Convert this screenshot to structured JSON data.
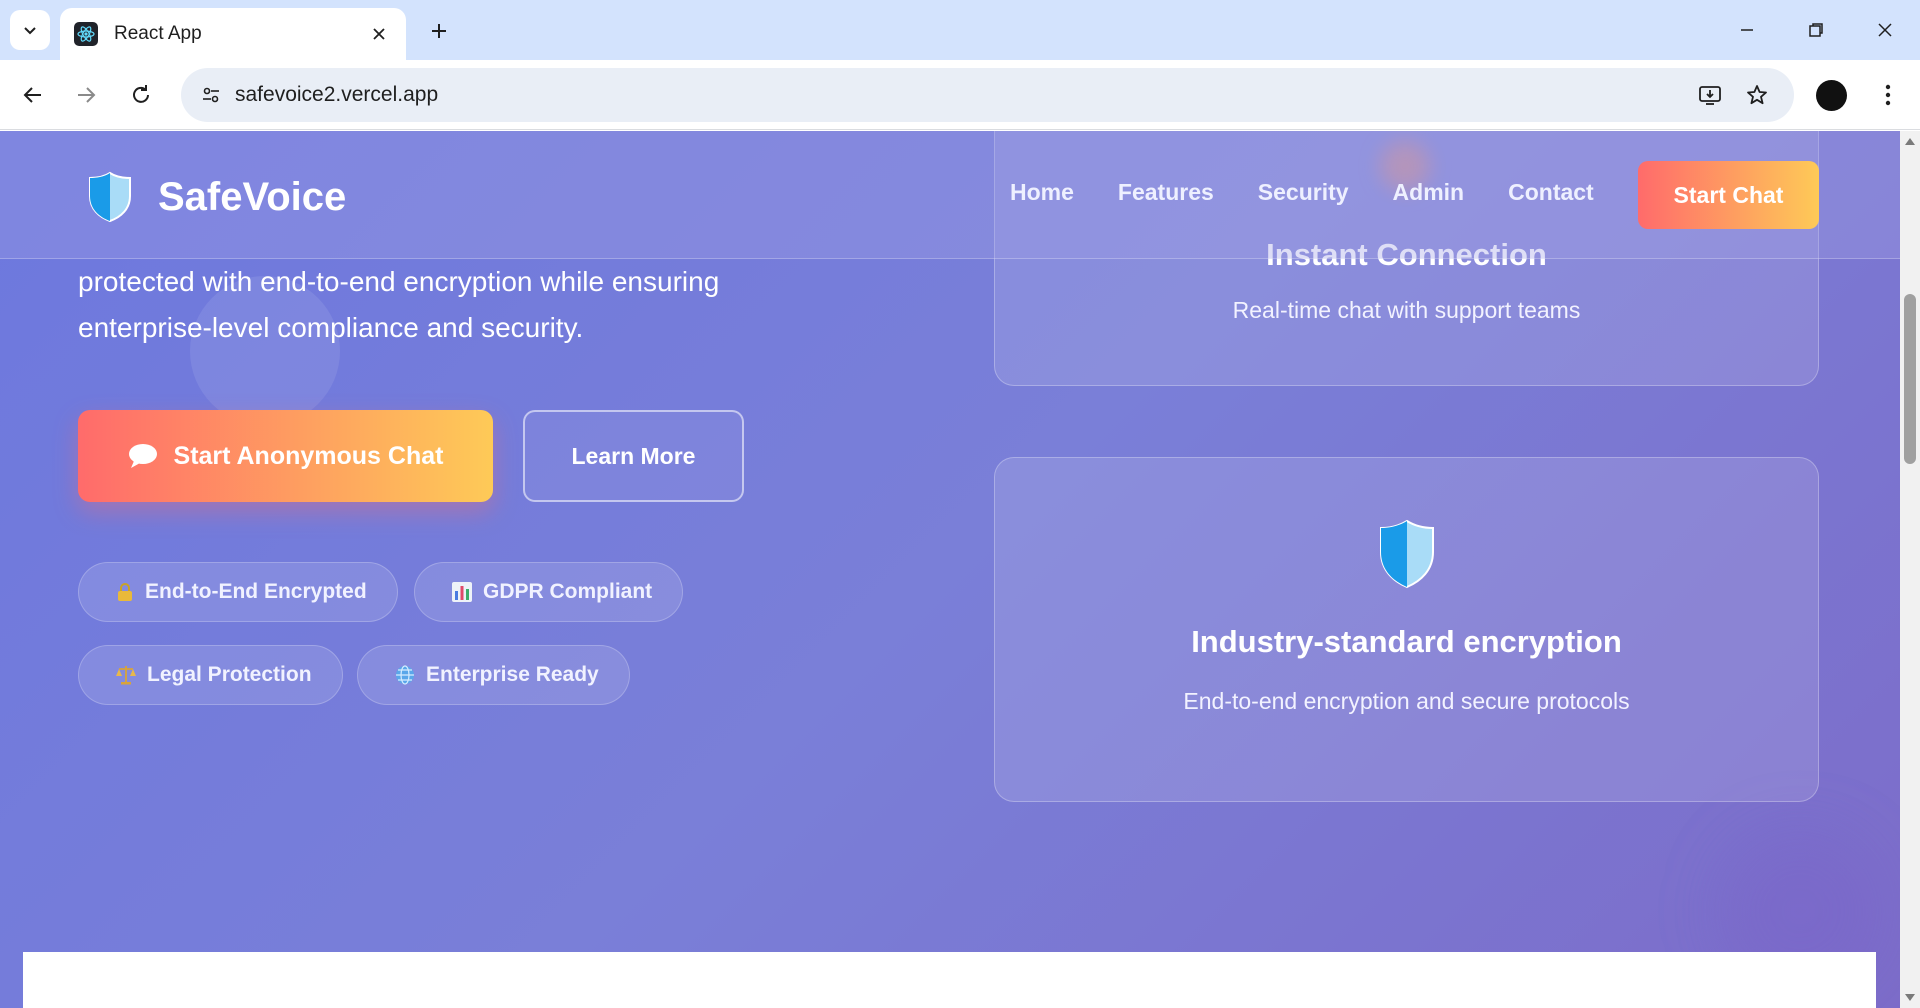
{
  "browser": {
    "tab_title": "React App",
    "url": "safevoice2.vercel.app"
  },
  "header": {
    "brand": "SafeVoice",
    "nav": [
      "Home",
      "Features",
      "Security",
      "Admin",
      "Contact"
    ],
    "cta": "Start Chat"
  },
  "hero": {
    "text_line1": "protected with end-to-end encryption while ensuring",
    "text_line2": "enterprise-level compliance and security.",
    "primary_button": "Start Anonymous Chat",
    "secondary_button": "Learn More",
    "badges": [
      {
        "label": "End-to-End Encrypted",
        "icon": "lock-icon"
      },
      {
        "label": "GDPR Compliant",
        "icon": "bar-chart-icon"
      },
      {
        "label": "Legal Protection",
        "icon": "scales-icon"
      },
      {
        "label": "Enterprise Ready",
        "icon": "globe-icon"
      }
    ]
  },
  "cards": [
    {
      "title": "Instant Connection",
      "description": "Real-time chat with support teams"
    },
    {
      "title": "Industry-standard encryption",
      "description": "End-to-end encryption and secure protocols",
      "icon": "shield-icon"
    }
  ],
  "colors": {
    "gradient_start": "#ff6b6b",
    "gradient_end": "#feca57",
    "background": "#7a7fd8"
  }
}
